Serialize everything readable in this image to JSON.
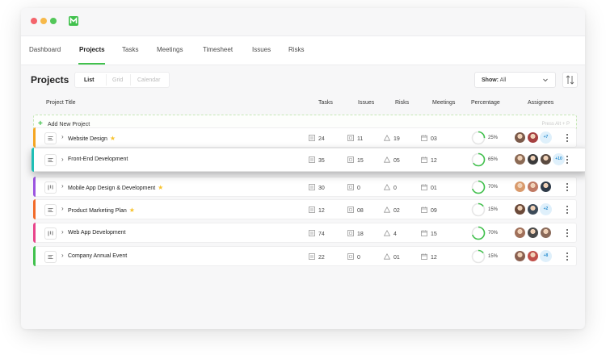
{
  "window_controls": {
    "close_color": "#f4646c",
    "min_color": "#f7b94a",
    "max_color": "#53c759"
  },
  "brand_color": "#41c14d",
  "nav": {
    "tabs": [
      {
        "label": "Dashboard",
        "active": false
      },
      {
        "label": "Projects",
        "active": true
      },
      {
        "label": "Tasks",
        "active": false
      },
      {
        "label": "Meetings",
        "active": false
      },
      {
        "label": "Timesheet",
        "active": false
      },
      {
        "label": "Issues",
        "active": false
      },
      {
        "label": "Risks",
        "active": false
      }
    ]
  },
  "page": {
    "title": "Projects",
    "view_tabs": [
      {
        "label": "List",
        "active": true
      },
      {
        "label": "Grid",
        "active": false
      },
      {
        "label": "Calendar",
        "active": false
      }
    ],
    "show_filter": {
      "label": "Show:",
      "value": "All"
    }
  },
  "table": {
    "columns": {
      "title": "Project Title",
      "tasks": "Tasks",
      "issues": "Issues",
      "risks": "Risks",
      "meetings": "Meetings",
      "percentage": "Percentage",
      "assignees": "Assignees"
    },
    "add_row": {
      "label": "Add New Project",
      "hint": "Press Alt + P"
    },
    "rows": [
      {
        "title": "Website Design",
        "starred": true,
        "type_icon": "list-icon",
        "accent": "#f5a623",
        "tasks": "24",
        "issues": "11",
        "risks": "19",
        "meetings": "03",
        "percent": 25,
        "percent_label": "25%",
        "avatars": [
          "#7b5a4a",
          "#a54040"
        ],
        "extra": "+7"
      },
      {
        "title": "Front-End Development",
        "starred": false,
        "type_icon": "list-icon",
        "accent": "#1fbfb6",
        "tasks": "35",
        "issues": "15",
        "risks": "05",
        "meetings": "12",
        "percent": 65,
        "percent_label": "65%",
        "avatars": [
          "#8b6a55",
          "#3a3a3a",
          "#5a4a40"
        ],
        "extra": "+10"
      },
      {
        "title": "Mobile App Design & Development",
        "starred": true,
        "type_icon": "kanban-icon",
        "accent": "#9c55e0",
        "tasks": "30",
        "issues": "0",
        "risks": "0",
        "meetings": "01",
        "percent": 70,
        "percent_label": "70%",
        "avatars": [
          "#d99a6c",
          "#c07a64",
          "#2e3a48"
        ],
        "extra": ""
      },
      {
        "title": "Product Marketing Plan",
        "starred": true,
        "type_icon": "list-icon",
        "accent": "#f26b2a",
        "tasks": "12",
        "issues": "08",
        "risks": "02",
        "meetings": "09",
        "percent": 15,
        "percent_label": "15%",
        "avatars": [
          "#6b4a3a",
          "#3c4a58"
        ],
        "extra": "+2"
      },
      {
        "title": "Web App Development",
        "starred": false,
        "type_icon": "kanban-icon",
        "accent": "#e8458b",
        "tasks": "74",
        "issues": "18",
        "risks": "4",
        "meetings": "15",
        "percent": 70,
        "percent_label": "70%",
        "avatars": [
          "#a0705a",
          "#4a4a4a",
          "#8a6a5a"
        ],
        "extra": ""
      },
      {
        "title": "Company Annual Event",
        "starred": false,
        "type_icon": "list-icon",
        "accent": "#41c14d",
        "tasks": "22",
        "issues": "0",
        "risks": "01",
        "meetings": "12",
        "percent": 15,
        "percent_label": "15%",
        "avatars": [
          "#8a6050",
          "#c0504a"
        ],
        "extra": "+8"
      }
    ]
  }
}
